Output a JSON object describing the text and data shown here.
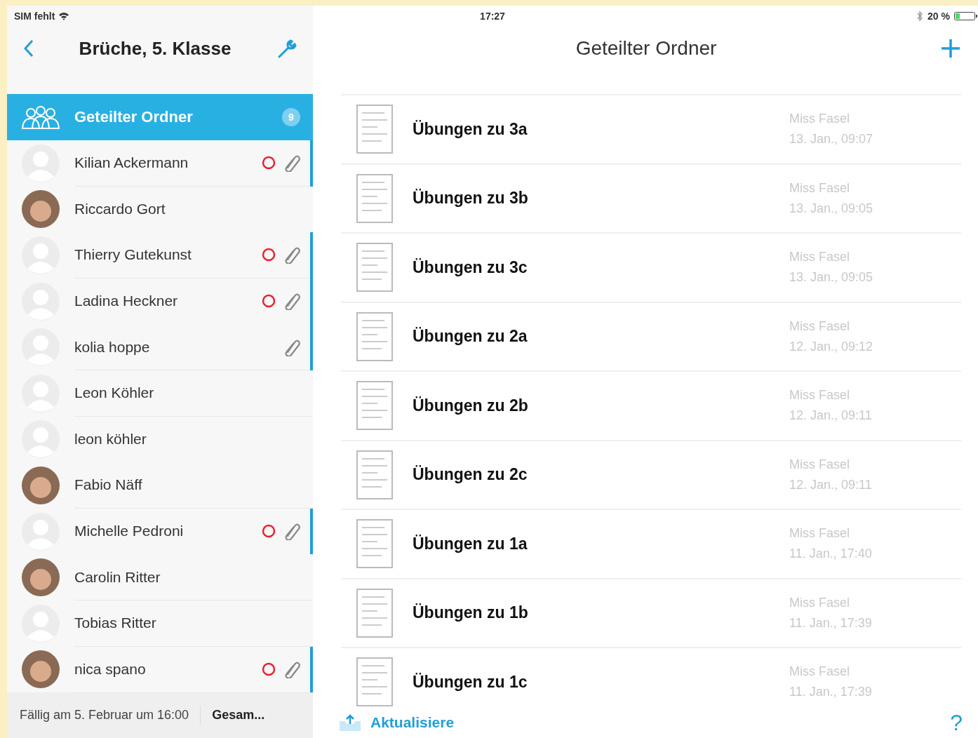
{
  "status_bar": {
    "carrier": "SIM fehlt",
    "time": "17:27",
    "battery": "20 %"
  },
  "sidebar": {
    "title": "Brüche, 5. Klasse",
    "folder": {
      "label": "Geteilter Ordner",
      "badge": "9",
      "selected": true
    },
    "students": [
      {
        "name": "Kilian Ackermann",
        "photo": false,
        "pending": true,
        "attachment": true,
        "selected": false
      },
      {
        "name": "Riccardo Gort",
        "photo": true,
        "pending": false,
        "attachment": false,
        "selected": false
      },
      {
        "name": "Thierry Gutekunst",
        "photo": false,
        "pending": true,
        "attachment": true,
        "selected": false
      },
      {
        "name": "Ladina Heckner",
        "photo": false,
        "pending": true,
        "attachment": true,
        "selected": false
      },
      {
        "name": "kolia hoppe",
        "photo": false,
        "pending": false,
        "attachment": true,
        "selected": false
      },
      {
        "name": "Leon Köhler",
        "photo": false,
        "pending": false,
        "attachment": false,
        "selected": false
      },
      {
        "name": "leon köhler",
        "photo": false,
        "pending": false,
        "attachment": false,
        "selected": false
      },
      {
        "name": "Fabio Näff",
        "photo": true,
        "pending": false,
        "attachment": false,
        "selected": false
      },
      {
        "name": "Michelle Pedroni",
        "photo": false,
        "pending": true,
        "attachment": true,
        "selected": false
      },
      {
        "name": "Carolin Ritter",
        "photo": true,
        "pending": false,
        "attachment": false,
        "selected": false
      },
      {
        "name": "Tobias Ritter",
        "photo": false,
        "pending": false,
        "attachment": false,
        "selected": false
      },
      {
        "name": "nica spano",
        "photo": true,
        "pending": true,
        "attachment": true,
        "selected": false
      }
    ],
    "footer": {
      "due": "Fällig am 5. Februar um 16:00",
      "total": "Gesam..."
    }
  },
  "main": {
    "title": "Geteilter Ordner",
    "files": [
      {
        "name": "Übungen zu 3a",
        "author": "Miss Fasel",
        "date": "13. Jan., 09:07"
      },
      {
        "name": "Übungen zu 3b",
        "author": "Miss Fasel",
        "date": "13. Jan., 09:05"
      },
      {
        "name": "Übungen zu 3c",
        "author": "Miss Fasel",
        "date": "13. Jan., 09:05"
      },
      {
        "name": "Übungen zu 2a",
        "author": "Miss Fasel",
        "date": "12. Jan., 09:12"
      },
      {
        "name": "Übungen zu 2b",
        "author": "Miss Fasel",
        "date": "12. Jan., 09:11"
      },
      {
        "name": "Übungen zu 2c",
        "author": "Miss Fasel",
        "date": "12. Jan., 09:11"
      },
      {
        "name": "Übungen zu 1a",
        "author": "Miss Fasel",
        "date": "11. Jan., 17:40"
      },
      {
        "name": "Übungen zu 1b",
        "author": "Miss Fasel",
        "date": "11. Jan., 17:39"
      },
      {
        "name": "Übungen zu 1c",
        "author": "Miss Fasel",
        "date": "11. Jan., 17:39"
      }
    ],
    "refresh": "Aktualisiere",
    "help": "?"
  }
}
